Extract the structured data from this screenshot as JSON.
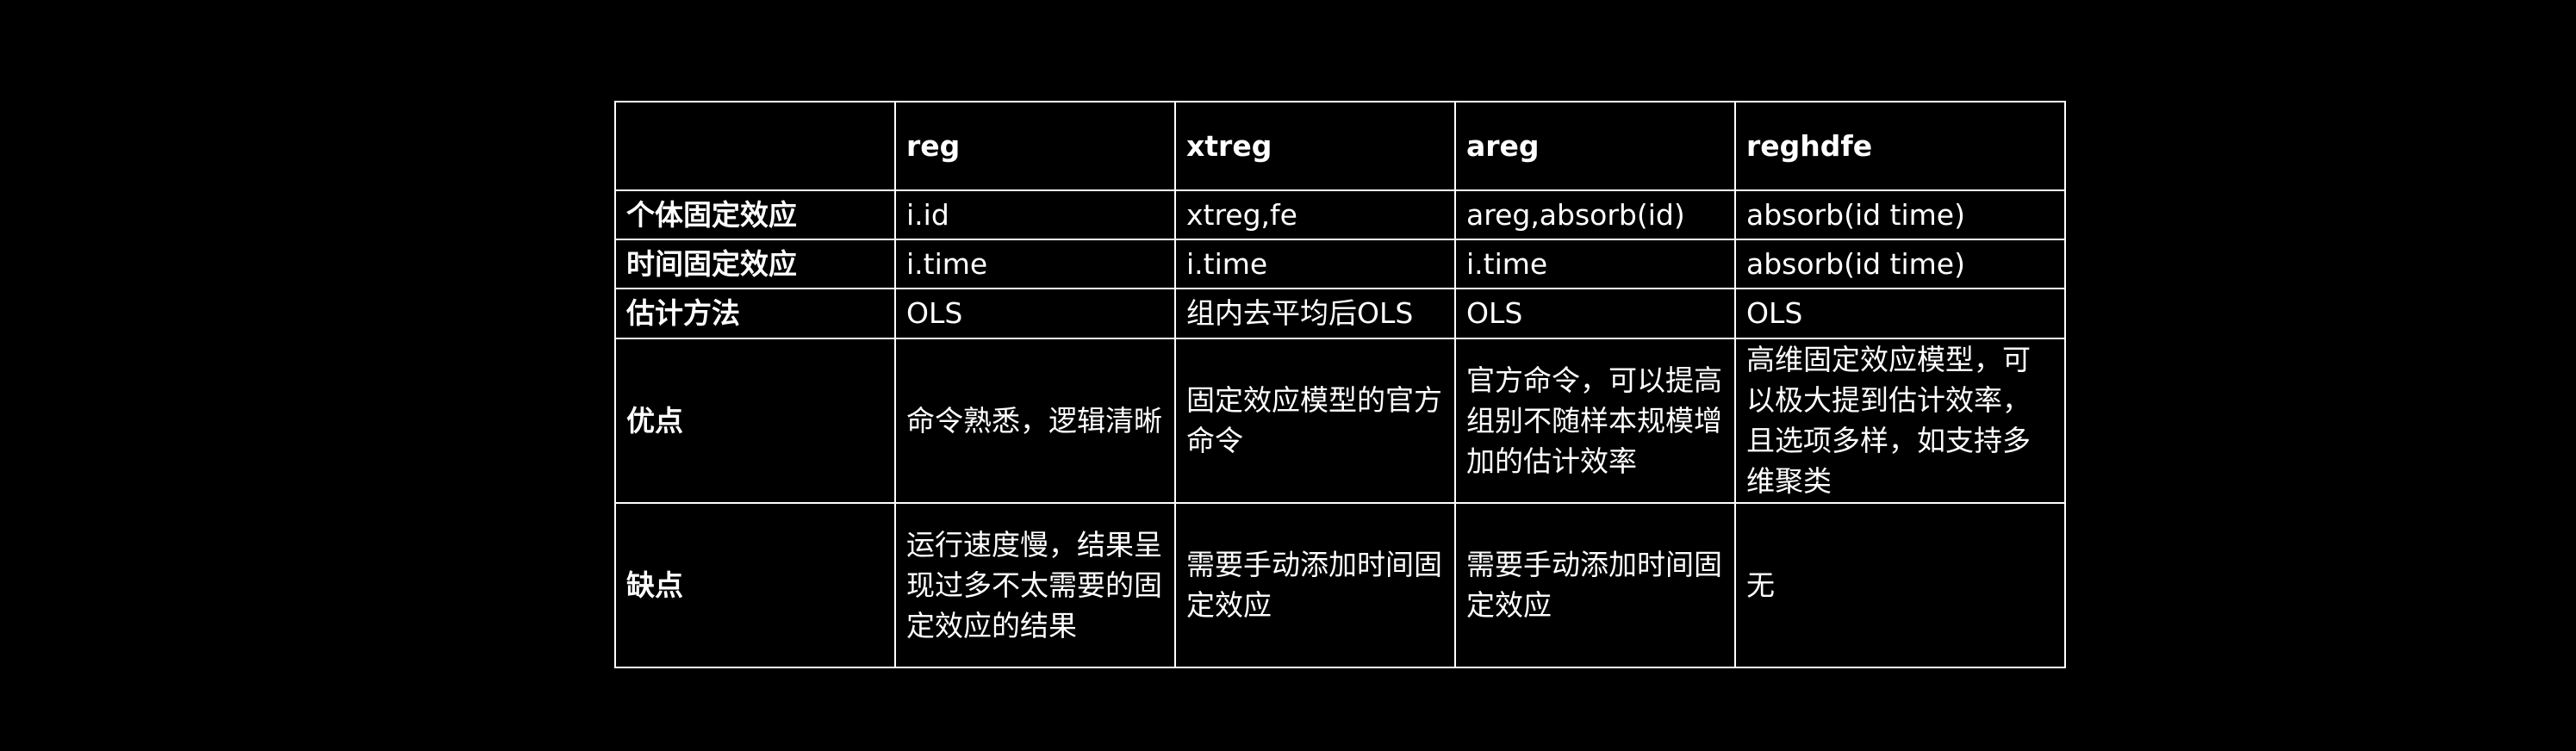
{
  "table": {
    "header": [
      "",
      "reg",
      "xtreg",
      "areg",
      "reghdfe"
    ],
    "rows": [
      {
        "label": "个体固定效应",
        "cells": [
          "i.id",
          "xtreg,fe",
          "areg,absorb(id)",
          "absorb(id time)"
        ]
      },
      {
        "label": "时间固定效应",
        "cells": [
          "i.time",
          "i.time",
          "i.time",
          "absorb(id time)"
        ]
      },
      {
        "label": "估计方法",
        "cells": [
          "OLS",
          "组内去平均后OLS",
          "OLS",
          "OLS"
        ]
      },
      {
        "label": "优点",
        "cells": [
          "命令熟悉，逻辑清晰",
          "固定效应模型的官方命令",
          "官方命令，可以提高组别不随样本规模增加的估计效率",
          "高维固定效应模型，可以极大提到估计效率，且选项多样，如支持多维聚类"
        ]
      },
      {
        "label": "缺点",
        "cells": [
          "运行速度慢，结果呈现过多不太需要的固定效应的结果",
          "需要手动添加时间固定效应",
          "需要手动添加时间固定效应",
          "无"
        ]
      }
    ]
  }
}
